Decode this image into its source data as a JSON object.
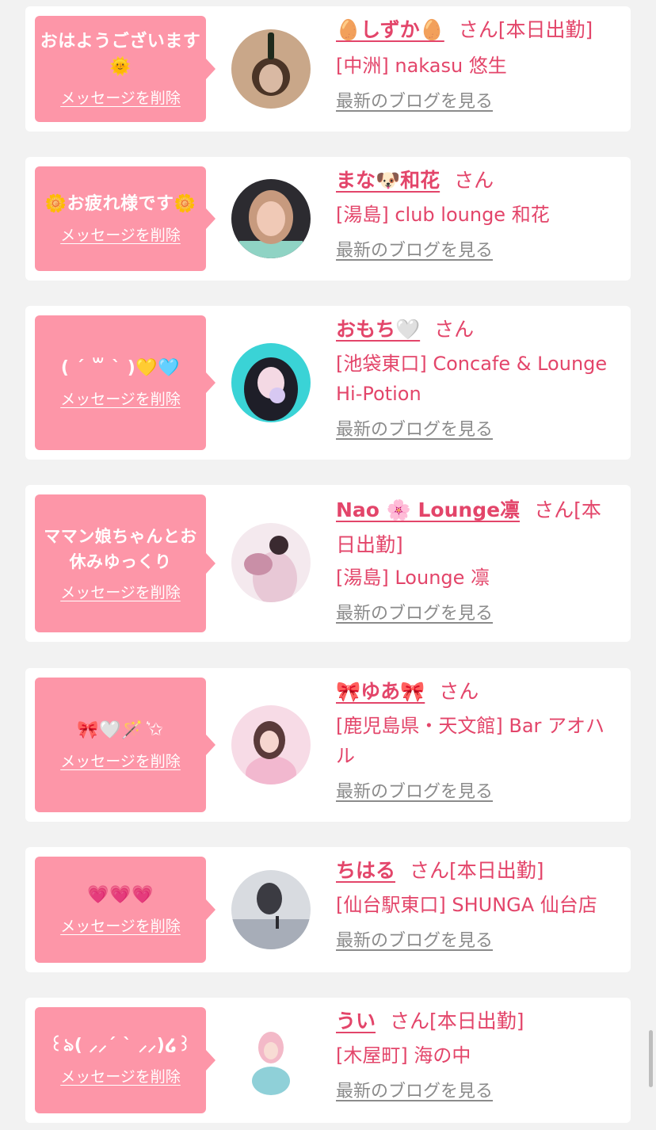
{
  "items": [
    {
      "message": "おはようございます🌞",
      "delete_label": "メッセージを削除",
      "name": "🥚しずか🥚",
      "san": "さん",
      "on_duty": "[本日出勤]",
      "shop": "[中洲] nakasu 悠生",
      "blog_label": "最新のブログを見る",
      "avatar_colors": [
        "#c9a789",
        "#4a3426",
        "#d9b9a3"
      ]
    },
    {
      "message": "🌼お疲れ様です🌼",
      "delete_label": "メッセージを削除",
      "name": "まな🐶和花",
      "san": "さん",
      "on_duty": "",
      "shop": "[湯島] club lounge 和花",
      "blog_label": "最新のブログを見る",
      "avatar_colors": [
        "#2c2b30",
        "#f0c9b6",
        "#8fd3c4"
      ]
    },
    {
      "message": "( ´ ꒳ ` )💛🩵",
      "delete_label": "メッセージを削除",
      "name": "おもち🤍",
      "san": "さん",
      "on_duty": "",
      "shop": "[池袋東口] Concafe & Lounge Hi-Potion",
      "blog_label": "最新のブログを見る",
      "avatar_colors": [
        "#3ad3d6",
        "#1e1e28",
        "#f4d9e4"
      ]
    },
    {
      "message": "ママン娘ちゃんとお休みゆっくり",
      "delete_label": "メッセージを削除",
      "name": "Nao 🌸 Lounge凛",
      "san": "さん",
      "on_duty": "[本日出勤]",
      "shop": "[湯島] Lounge 凛",
      "blog_label": "最新のブログを見る",
      "avatar_colors": [
        "#f4e9ee",
        "#c98fa7",
        "#e8c8d6"
      ]
    },
    {
      "message": "🎀🤍🪄 ͛✩",
      "delete_label": "メッセージを削除",
      "name": "🎀ゆあ🎀",
      "san": "さん",
      "on_duty": "",
      "shop": "[鹿児島県・天文館] Bar アオハル",
      "blog_label": "最新のブログを見る",
      "avatar_colors": [
        "#f7dbe6",
        "#5a3a3a",
        "#f2b8cf"
      ]
    },
    {
      "message": "💗💗💗",
      "delete_label": "メッセージを削除",
      "name": "ちはる",
      "san": "さん",
      "on_duty": "[本日出勤]",
      "shop": "[仙台駅東口] SHUNGA 仙台店",
      "blog_label": "最新のブログを見る",
      "avatar_colors": [
        "#d8dbe0",
        "#3b3b42",
        "#a7adb8"
      ]
    },
    {
      "message": "꒰ঌ( ⸝⸝´ ` ⸝⸝)໒꒱",
      "delete_label": "メッセージを削除",
      "name": "うい",
      "san": "さん",
      "on_duty": "[本日出勤]",
      "shop": "[木屋町] 海の中",
      "blog_label": "最新のブログを見る",
      "avatar_colors": [
        "#ffffff",
        "#8fd0d8",
        "#f3b9c8"
      ]
    }
  ]
}
